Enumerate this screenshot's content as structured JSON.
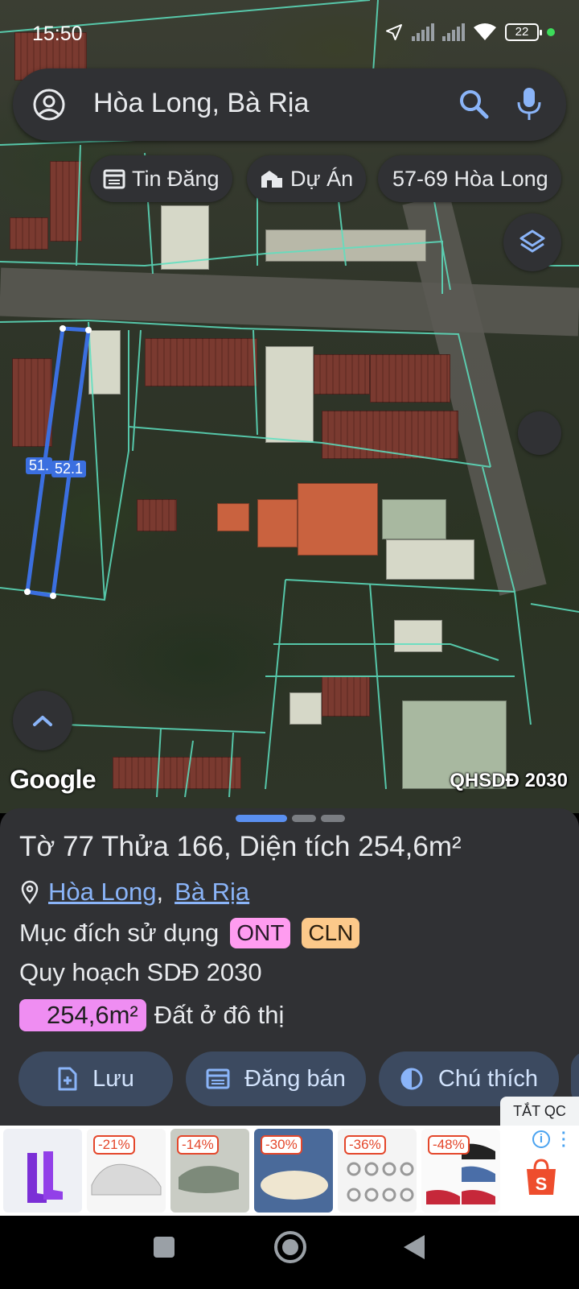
{
  "status_bar": {
    "time": "15:50",
    "battery": "22"
  },
  "search": {
    "query": "Hòa Long, Bà Rịa"
  },
  "chips": [
    {
      "label": "Tin Đăng",
      "icon": "calendar-list-icon"
    },
    {
      "label": "Dự Án",
      "icon": "building-icon"
    },
    {
      "label": "57-69 Hòa Long"
    }
  ],
  "map": {
    "measure_left": "51.",
    "measure_right": "52.1",
    "google_logo": "Google",
    "layer_label": "QHSDĐ 2030"
  },
  "sheet": {
    "title": "Tờ 77 Thửa 166, Diện tích 254,6m²",
    "location": {
      "ward": "Hòa Long",
      "separator": ",",
      "city": "Bà Rịa"
    },
    "purpose_label": "Mục đích sử dụng",
    "badges": [
      "ONT",
      "CLN"
    ],
    "plan_label": "Quy hoạch SDĐ 2030",
    "area_value": "254,6m²",
    "area_desc": "Đất ở đô thị",
    "actions": [
      {
        "label": "Lưu",
        "icon": "save-add-icon"
      },
      {
        "label": "Đăng bán",
        "icon": "calendar-list-icon"
      },
      {
        "label": "Chú thích",
        "icon": "contrast-icon"
      }
    ]
  },
  "ads": {
    "close_label": "TẮT QC",
    "items": [
      {
        "discount": ""
      },
      {
        "discount": "-21%"
      },
      {
        "discount": "-14%"
      },
      {
        "discount": "-30%"
      },
      {
        "discount": "-36%"
      },
      {
        "discount": "-48%"
      }
    ]
  },
  "colors": {
    "accent": "#8ab4f8",
    "parcel_line": "#5de0c0",
    "selected_parcel": "#3b6fe0"
  }
}
